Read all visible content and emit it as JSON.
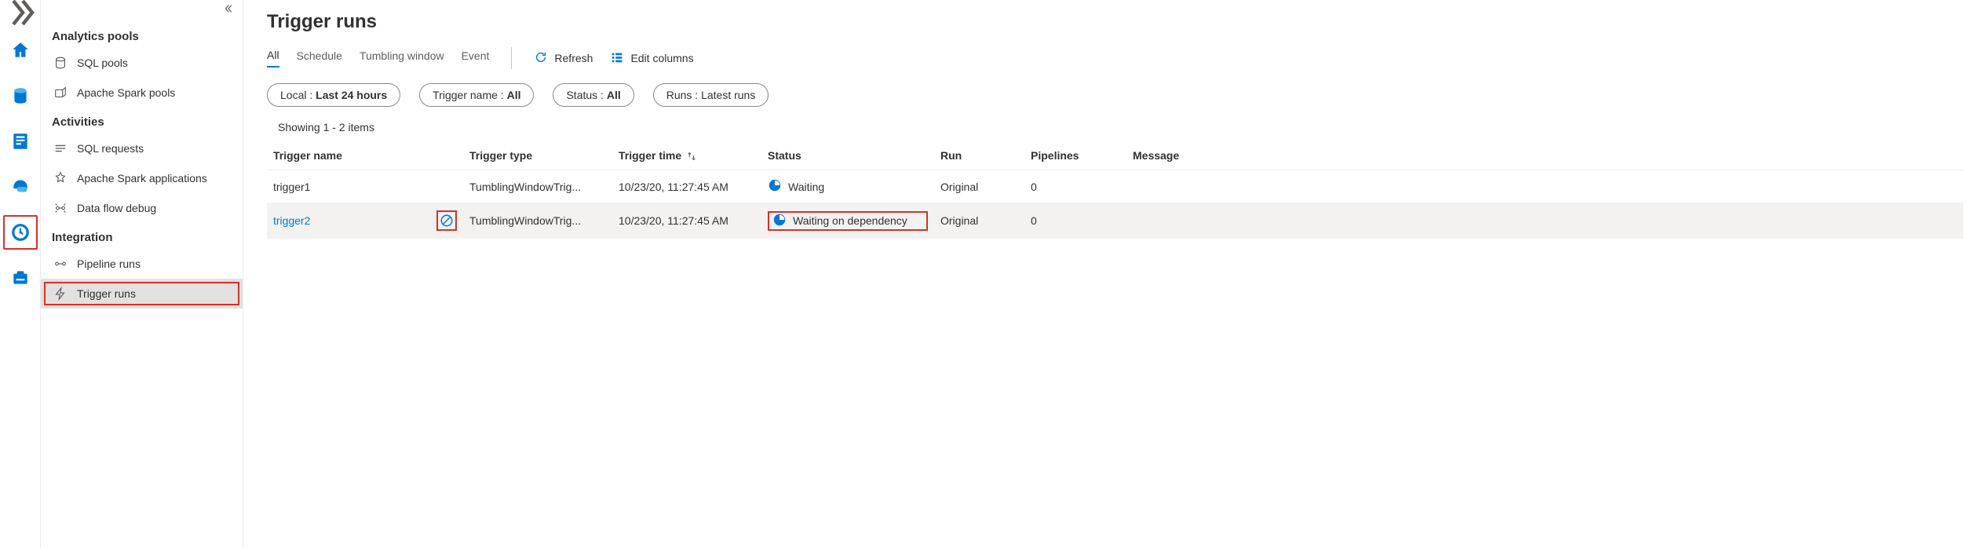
{
  "page": {
    "title": "Trigger runs"
  },
  "sidebar": {
    "sections": [
      {
        "title": "Analytics pools",
        "items": [
          {
            "label": "SQL pools"
          },
          {
            "label": "Apache Spark pools"
          }
        ]
      },
      {
        "title": "Activities",
        "items": [
          {
            "label": "SQL requests"
          },
          {
            "label": "Apache Spark applications"
          },
          {
            "label": "Data flow debug"
          }
        ]
      },
      {
        "title": "Integration",
        "items": [
          {
            "label": "Pipeline runs"
          },
          {
            "label": "Trigger runs"
          }
        ]
      }
    ]
  },
  "tabs": {
    "items": [
      {
        "label": "All"
      },
      {
        "label": "Schedule"
      },
      {
        "label": "Tumbling window"
      },
      {
        "label": "Event"
      }
    ]
  },
  "commands": {
    "refresh": "Refresh",
    "edit_columns": "Edit columns"
  },
  "filters": {
    "local_label": "Local : ",
    "local_value": "Last 24 hours",
    "trigger_label": "Trigger name : ",
    "trigger_value": "All",
    "status_label": "Status : ",
    "status_value": "All",
    "runs_label": "Runs : ",
    "runs_value": "Latest runs"
  },
  "results": {
    "count_text": "Showing 1 - 2 items",
    "columns": {
      "trigger_name": "Trigger name",
      "trigger_type": "Trigger type",
      "trigger_time": "Trigger time",
      "status": "Status",
      "run": "Run",
      "pipelines": "Pipelines",
      "message": "Message"
    },
    "rows": [
      {
        "name": "trigger1",
        "type": "TumblingWindowTrig...",
        "time": "10/23/20, 11:27:45 AM",
        "status": "Waiting",
        "run": "Original",
        "pipelines": "0",
        "message": ""
      },
      {
        "name": "trigger2",
        "type": "TumblingWindowTrig...",
        "time": "10/23/20, 11:27:45 AM",
        "status": "Waiting on dependency",
        "run": "Original",
        "pipelines": "0",
        "message": ""
      }
    ]
  }
}
